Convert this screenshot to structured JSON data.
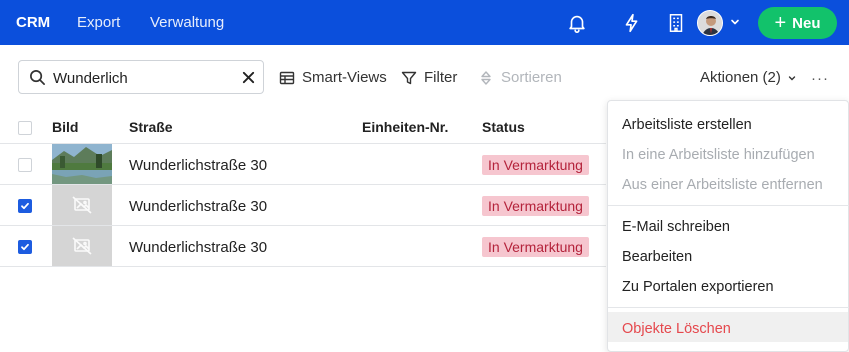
{
  "topbar": {
    "nav": [
      "CRM",
      "Export",
      "Verwaltung"
    ],
    "new_button": "Neu",
    "icons": [
      "bell-icon",
      "bolt-icon",
      "building-icon",
      "avatar",
      "chevron-down-icon"
    ],
    "colors": {
      "bar": "#0b4fdc",
      "new_button": "#12c26b"
    }
  },
  "toolbar": {
    "search_value": "Wunderlich",
    "smart_views": "Smart-Views",
    "filter": "Filter",
    "sort": "Sortieren",
    "actions": "Aktionen (2)",
    "more": "···"
  },
  "table": {
    "headers": {
      "image": "Bild",
      "street": "Straße",
      "unit": "Einheiten-Nr.",
      "status": "Status"
    },
    "rows": [
      {
        "street": "Wunderlichstraße 30",
        "unit": "",
        "status": "In Vermarktung",
        "checked": false,
        "has_photo": true
      },
      {
        "street": "Wunderlichstraße 30",
        "unit": "",
        "status": "In Vermarktung",
        "checked": true,
        "has_photo": false
      },
      {
        "street": "Wunderlichstraße 30",
        "unit": "",
        "status": "In Vermarktung",
        "checked": true,
        "has_photo": false
      }
    ]
  },
  "menu": {
    "items": [
      {
        "label": "Arbeitsliste erstellen",
        "state": "enabled"
      },
      {
        "label": "In eine Arbeitsliste hinzufügen",
        "state": "disabled"
      },
      {
        "label": "Aus einer Arbeitsliste entfernen",
        "state": "disabled"
      },
      {
        "label": "E-Mail schreiben",
        "state": "enabled"
      },
      {
        "label": "Bearbeiten",
        "state": "enabled"
      },
      {
        "label": "Zu Portalen exportieren",
        "state": "enabled"
      },
      {
        "label": "Objekte Löschen",
        "state": "danger"
      }
    ],
    "colors": {
      "danger": "#e5484d",
      "disabled": "#a8acb1"
    }
  }
}
